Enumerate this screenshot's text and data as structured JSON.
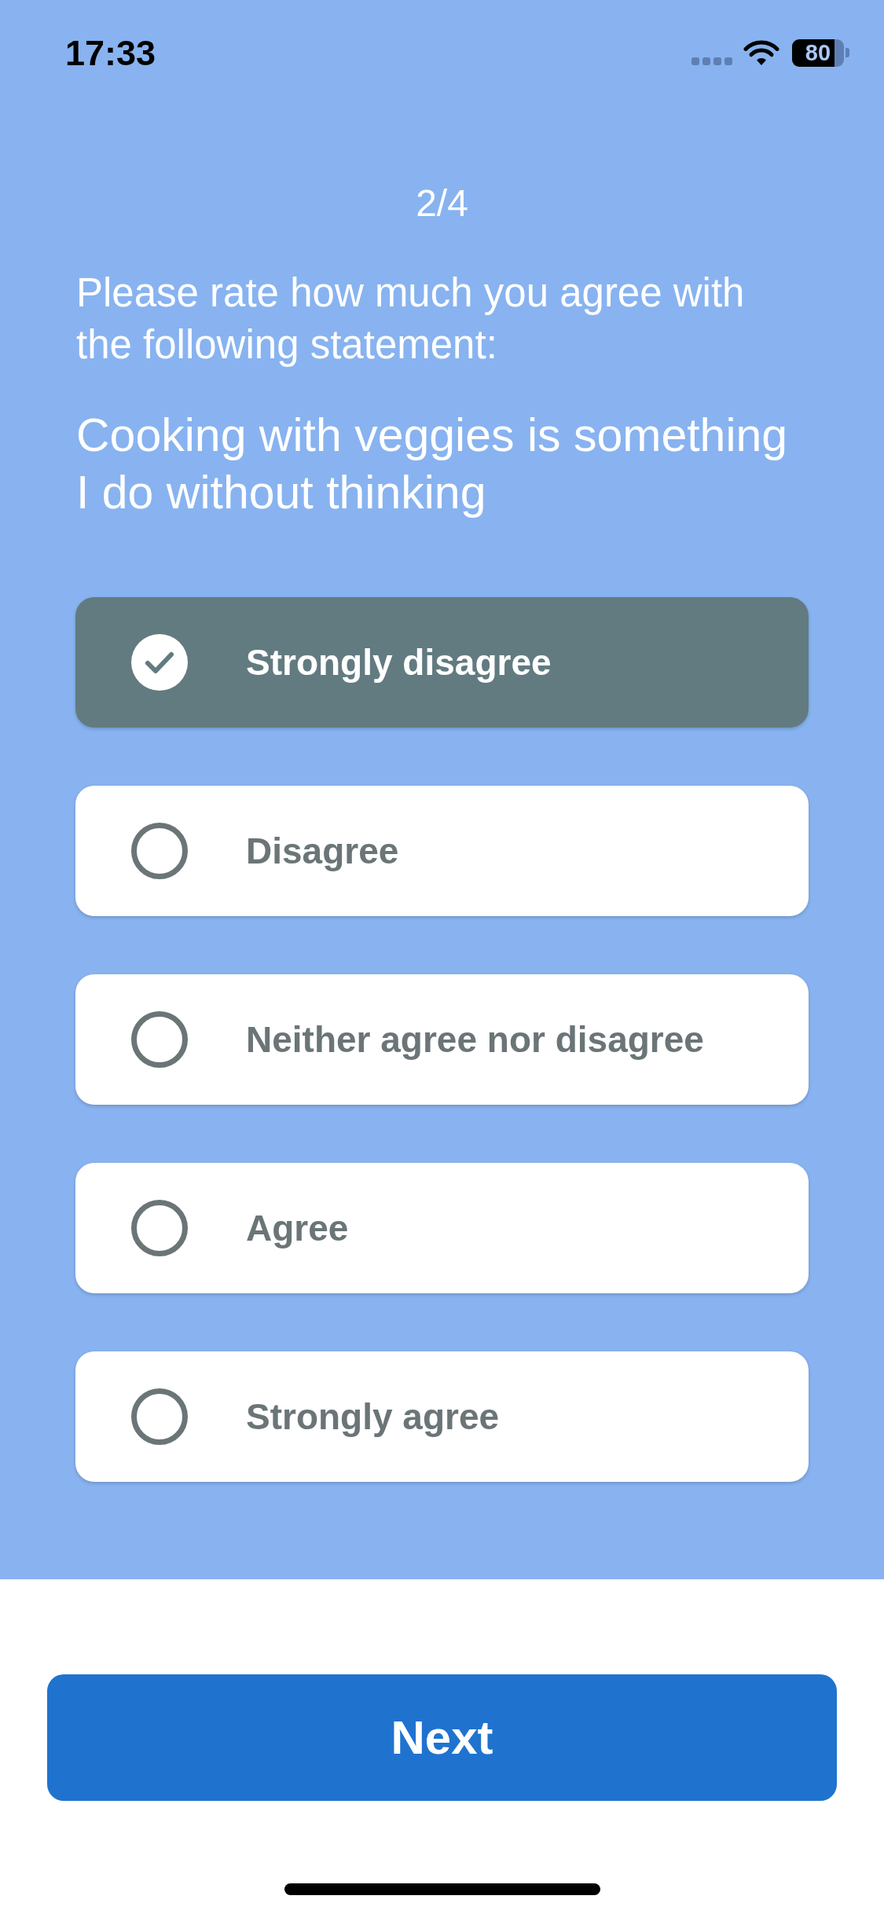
{
  "status_bar": {
    "time": "17:33",
    "battery": "80"
  },
  "progress": "2/4",
  "prompt": "Please rate how much you agree with the following statement:",
  "statement": "Cooking with veggies is something I do without thinking",
  "options": [
    {
      "label": "Strongly disagree",
      "selected": true
    },
    {
      "label": "Disagree",
      "selected": false
    },
    {
      "label": "Neither agree nor disagree",
      "selected": false
    },
    {
      "label": "Agree",
      "selected": false
    },
    {
      "label": "Strongly agree",
      "selected": false
    }
  ],
  "next_button": {
    "label": "Next"
  }
}
